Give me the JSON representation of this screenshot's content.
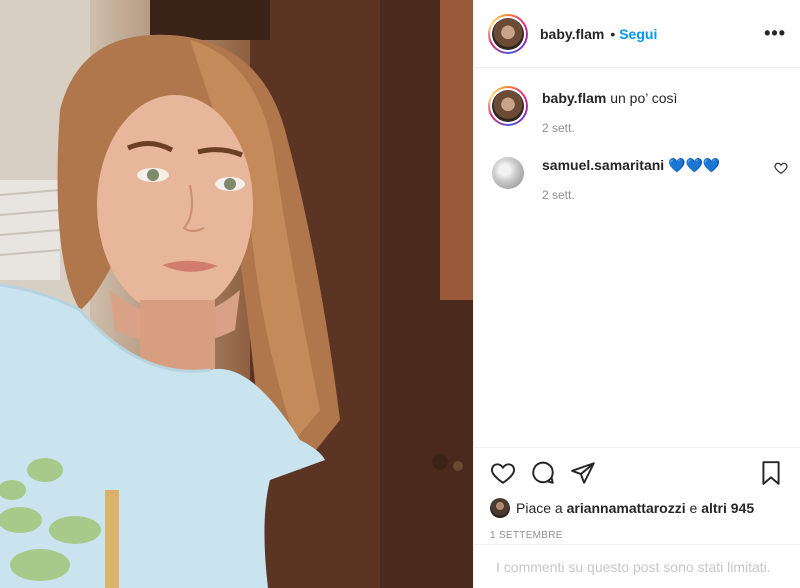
{
  "post": {
    "author": "baby.flam",
    "follow_label": "Segui",
    "more_label": "•••",
    "separator": "•"
  },
  "comments": [
    {
      "user": "baby.flam",
      "text": "un po’ così",
      "time": "2 sett."
    },
    {
      "user": "samuel.samaritani",
      "text": "💙💙💙",
      "time": "2 sett."
    }
  ],
  "likes": {
    "prefix": "Piace a",
    "liker": "ariannamattarozzi",
    "conjunction": "e",
    "others": "altri 945"
  },
  "post_date": "1 SETTEMBRE",
  "comments_limited": "I commenti su questo post sono stati limitati.",
  "icons": [
    "heart-icon",
    "comment-icon",
    "share-icon",
    "bookmark-icon",
    "more-options-icon"
  ],
  "colors": {
    "follow": "#0095f6",
    "muted": "#8e8e8e",
    "text": "#262626"
  }
}
